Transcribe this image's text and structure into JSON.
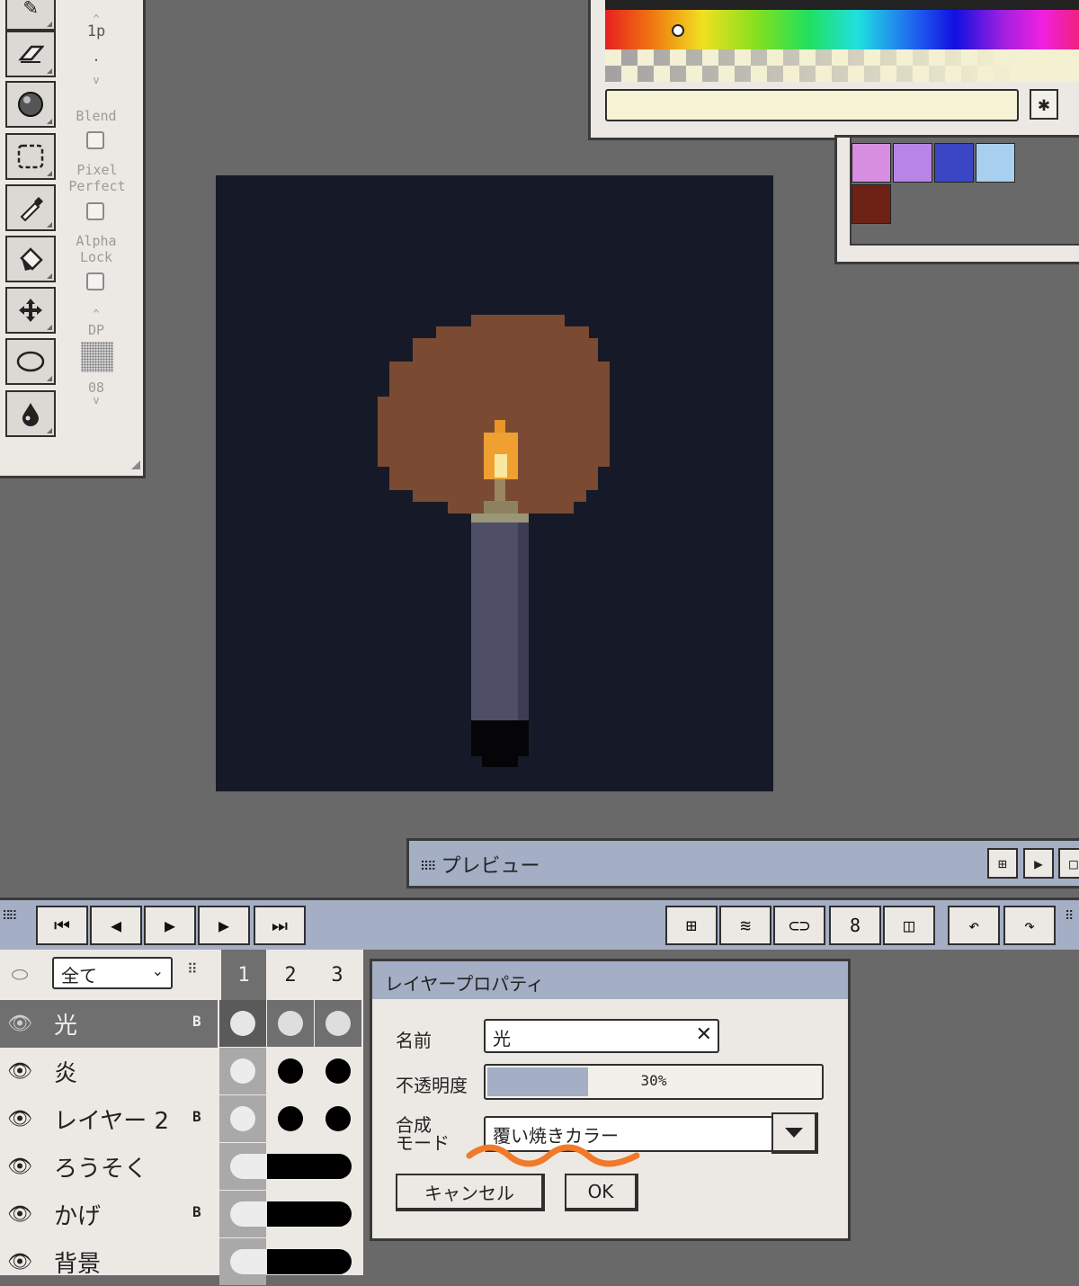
{
  "tools": {
    "options": {
      "brush_size": "1p",
      "blend_label": "Blend",
      "pixel_perfect_label": "Pixel Perfect",
      "alpha_lock_label": "Alpha Lock",
      "dp_label": "DP",
      "dp_value": "08"
    }
  },
  "color": {
    "hex_value": "",
    "star_label": "✱"
  },
  "palette": {
    "swatches": [
      "#d88ee0",
      "#b884e6",
      "#3a46c4",
      "#a8cfee",
      "#6e2216"
    ]
  },
  "preview": {
    "title": "プレビュー"
  },
  "layers": {
    "filter_value": "全て",
    "frame_numbers": [
      "1",
      "2",
      "3"
    ],
    "rows": [
      {
        "name": "光",
        "flag": "B",
        "selected": true
      },
      {
        "name": "炎",
        "flag": "",
        "selected": false
      },
      {
        "name": "レイヤー 2",
        "flag": "B",
        "selected": false
      },
      {
        "name": "ろうそく",
        "flag": "",
        "selected": false
      },
      {
        "name": "かげ",
        "flag": "B",
        "selected": false
      },
      {
        "name": "背景",
        "flag": "",
        "selected": false
      }
    ]
  },
  "dialog": {
    "title": "レイヤープロパティ",
    "name_label": "名前",
    "name_value": "光",
    "opacity_label": "不透明度",
    "opacity_value": "30%",
    "opacity_fraction": 0.3,
    "blend_label_1": "合成",
    "blend_label_2": "モード",
    "blend_value": "覆い焼きカラー",
    "cancel_label": "キャンセル",
    "ok_label": "OK"
  },
  "accent_colors": {
    "panel_bg": "#ece9e4",
    "titlebar": "#a4aec4",
    "canvas_bg": "#161a28",
    "annotation": "#f07a2a"
  }
}
